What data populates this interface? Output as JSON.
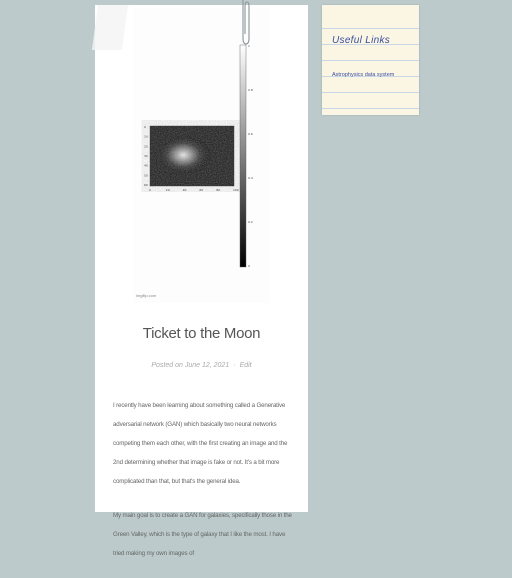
{
  "post": {
    "figure_credit": "imgflip.com",
    "title": "Ticket to the Moon",
    "meta_posted": "Posted on June 12, 2021",
    "meta_edit": "Edit",
    "paragraphs": [
      "I recently have been learning about something called a Generative adversarial network (GAN) which basically two neural networks competing them each other, with the first creating an image and the 2nd determining whether that image is fake or not. It's a bit more complicated than that, but that's the general idea.",
      "My main goal is to create a GAN for galaxies, specifically those in the Green Valley, which is the type of galaxy that I like the most. I have tried making my own images of"
    ]
  },
  "figure": {
    "x_ticks": [
      "0",
      "20",
      "40",
      "60",
      "80",
      "100"
    ],
    "y_ticks": [
      "0",
      "10",
      "20",
      "30",
      "40",
      "50",
      "60"
    ],
    "colorbar_ticks": [
      "1",
      "0.8",
      "0.6",
      "0.4",
      "0.2",
      "0"
    ]
  },
  "sidebar": {
    "title": "Useful Links",
    "links": [
      "Astrophysics data system"
    ]
  }
}
